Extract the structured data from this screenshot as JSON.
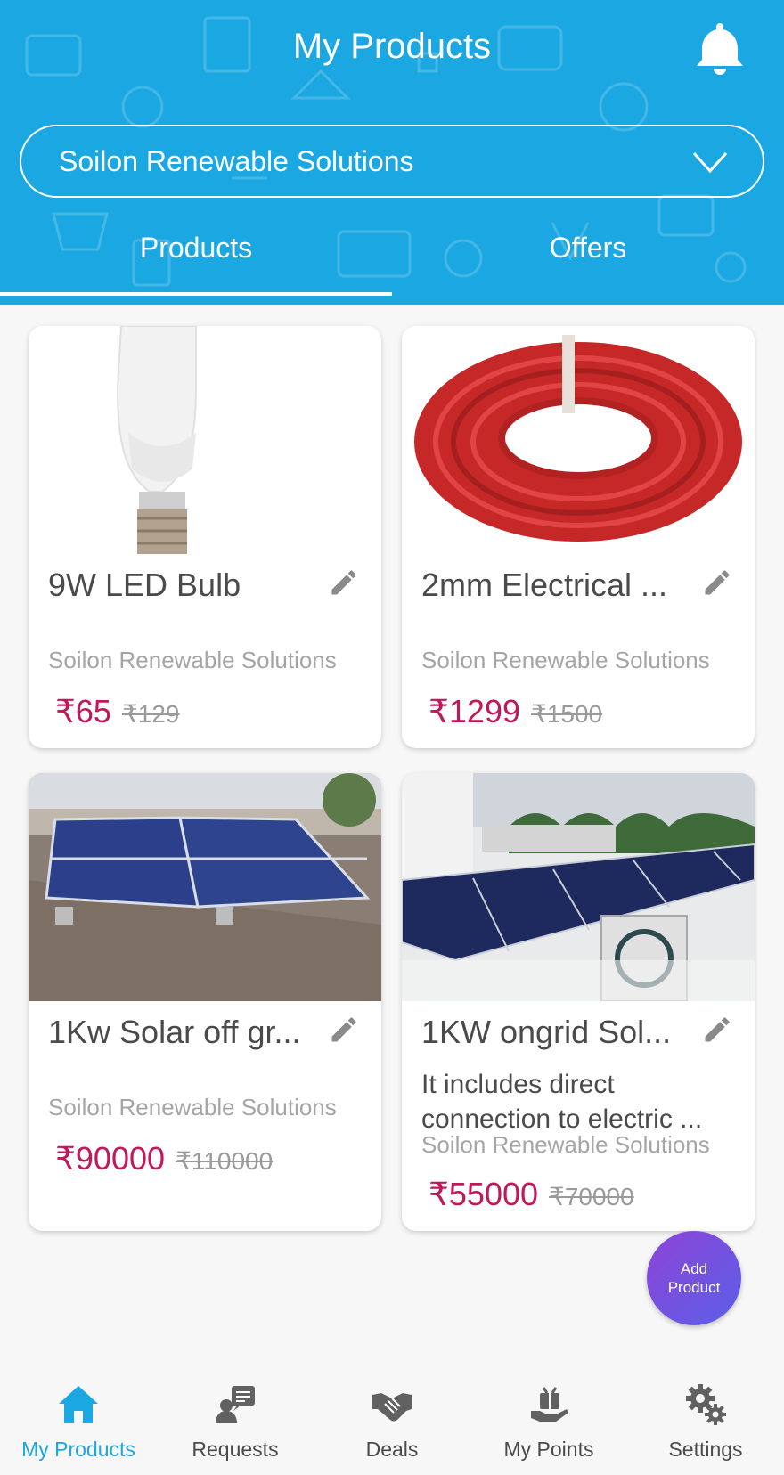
{
  "header": {
    "title": "My Products",
    "store_selector": "Soilon Renewable Solutions",
    "tabs": [
      {
        "label": "Products",
        "active": true
      },
      {
        "label": "Offers",
        "active": false
      }
    ]
  },
  "products": [
    {
      "name": "9W LED Bulb",
      "description": [],
      "seller": "Soilon Renewable Solutions",
      "price": "₹65",
      "mrp": "₹129"
    },
    {
      "name": "2mm Electrical ...",
      "description": [],
      "seller": "Soilon Renewable Solutions",
      "price": "₹1299",
      "mrp": "₹1500"
    },
    {
      "name": "1Kw Solar off gr...",
      "description": [],
      "seller": "Soilon Renewable Solutions",
      "price": "₹90000",
      "mrp": "₹110000"
    },
    {
      "name": "1KW ongrid Sol...",
      "description": [
        "It includes direct",
        "connection to electric ..."
      ],
      "seller": "Soilon Renewable Solutions",
      "price": "₹55000",
      "mrp": "₹70000"
    }
  ],
  "fab": {
    "line1": "Add",
    "line2": "Product"
  },
  "bottom_nav": [
    {
      "label": "My Products",
      "icon": "home-icon",
      "active": true
    },
    {
      "label": "Requests",
      "icon": "requests-icon",
      "active": false
    },
    {
      "label": "Deals",
      "icon": "handshake-icon",
      "active": false
    },
    {
      "label": "My Points",
      "icon": "points-icon",
      "active": false
    },
    {
      "label": "Settings",
      "icon": "gear-icon",
      "active": false
    }
  ],
  "colors": {
    "header": "#1ba7e1",
    "price": "#c2185b",
    "active_nav": "#1ba7e1",
    "fab_start": "#8e44d6",
    "fab_end": "#5b5fe8"
  }
}
